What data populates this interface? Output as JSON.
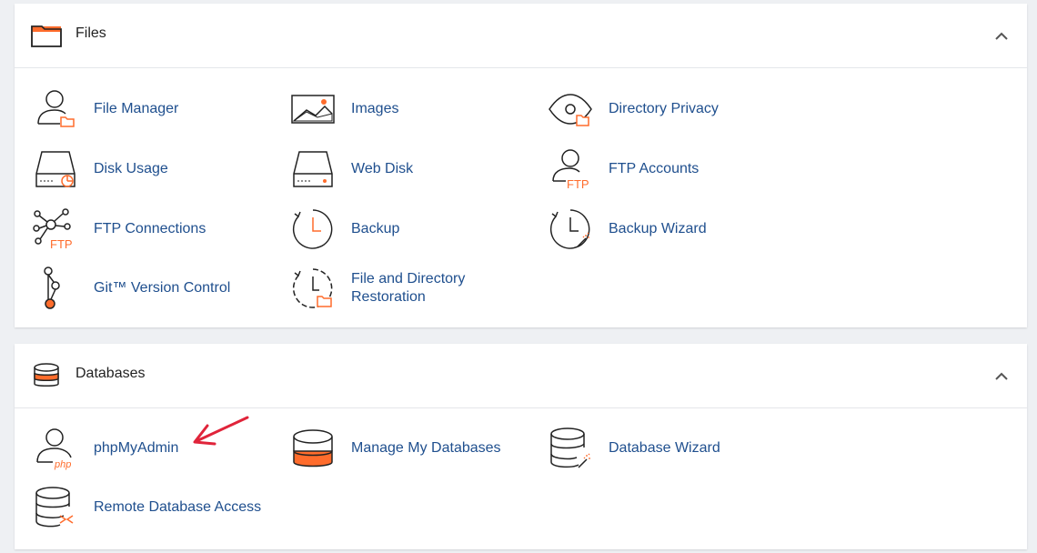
{
  "sections": {
    "files": {
      "title": "Files",
      "items": {
        "file_manager": "File Manager",
        "images": "Images",
        "directory_privacy": "Directory Privacy",
        "disk_usage": "Disk Usage",
        "web_disk": "Web Disk",
        "ftp_accounts": "FTP Accounts",
        "ftp_connections": "FTP Connections",
        "backup": "Backup",
        "backup_wizard": "Backup Wizard",
        "git_version_control": "Git™ Version Control",
        "file_dir_restoration_line1": "File and Directory",
        "file_dir_restoration_line2": "Restoration"
      },
      "icon_text": {
        "ftp": "FTP"
      }
    },
    "databases": {
      "title": "Databases",
      "items": {
        "phpmyadmin": "phpMyAdmin",
        "manage_my_databases": "Manage My Databases",
        "database_wizard": "Database Wizard",
        "remote_database_access": "Remote Database Access"
      },
      "icon_text": {
        "php": "php"
      }
    }
  },
  "colors": {
    "accent_orange": "#ff6c2c",
    "link_blue": "#1f4f8e",
    "annotation_red": "#e0243a"
  }
}
